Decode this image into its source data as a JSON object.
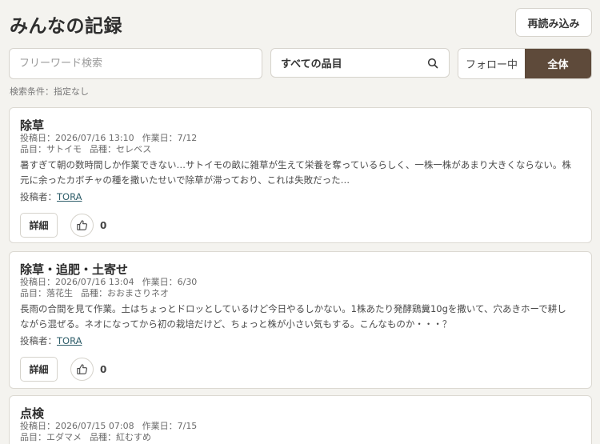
{
  "header": {
    "title": "みんなの記録",
    "reload_label": "再読み込み"
  },
  "filters": {
    "search_placeholder": "フリーワード検索",
    "category_selected": "すべての品目",
    "scope_follow": "フォロー中",
    "scope_all": "全体",
    "scope_active": "全体",
    "status": "検索条件：指定なし"
  },
  "posts": [
    {
      "title": "除草",
      "posted": "投稿日：2026/07/16 13:10",
      "work_date": "作業日：7/12",
      "item": "品目：サトイモ",
      "variety": "品種：セレベス",
      "body": "暑すぎて朝の数時間しか作業できない…サトイモの畝に雑草が生えて栄養を奪っているらしく、一株一株があまり大きくならない。株元に余ったカボチャの種を撒いたせいで除草が滞っており、これは失敗だった…",
      "author_label": "投稿者：",
      "author": "TORA",
      "detail_label": "詳細",
      "likes": "0"
    },
    {
      "title": "除草・追肥・土寄せ",
      "posted": "投稿日：2026/07/16 13:04",
      "work_date": "作業日：6/30",
      "item": "品目：落花生",
      "variety": "品種：おおまさりネオ",
      "body": "長雨の合間を見て作業。土はちょっとドロッとしているけど今日やるしかない。1株あたり発酵鶏糞10gを撒いて、穴あきホーで耕しながら混ぜる。ネオになってから初の栽培だけど、ちょっと株が小さい気もする。こんなものか・・・？",
      "author_label": "投稿者：",
      "author": "TORA",
      "detail_label": "詳細",
      "likes": "0"
    },
    {
      "title": "点検",
      "posted": "投稿日：2026/07/15 07:08",
      "work_date": "作業日：7/15",
      "item": "品目：エダマメ",
      "variety": "品種：紅むすめ"
    }
  ]
}
